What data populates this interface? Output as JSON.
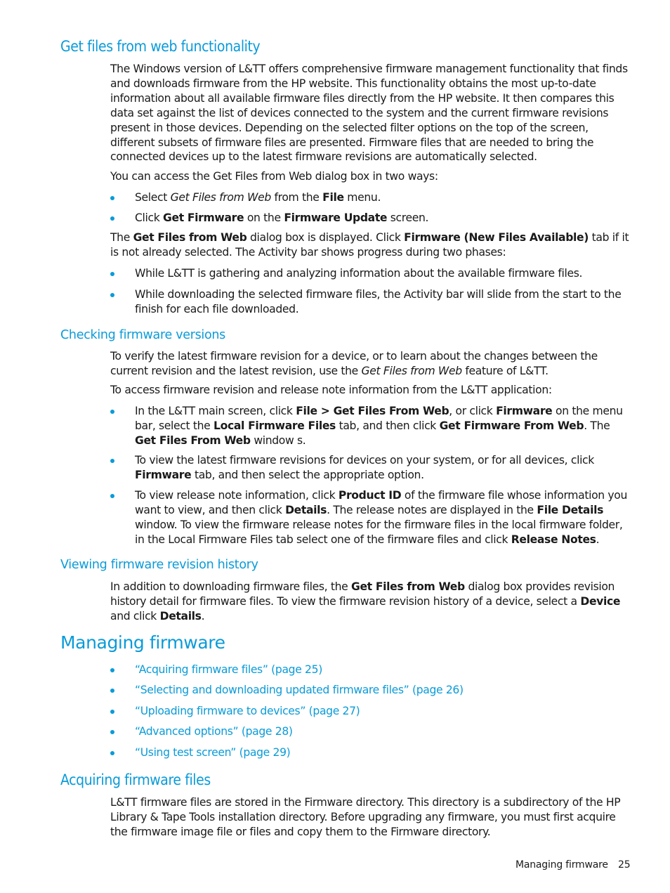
{
  "colors": {
    "accent": "#0a9bd8",
    "text": "#1a1a1a"
  },
  "sections": {
    "get_files": {
      "heading": "Get files from web functionality",
      "p1": "The Windows version of L&TT offers comprehensive firmware management functionality that finds and downloads firmware from the HP website. This functionality obtains the most up-to-date information about all available firmware files directly from the HP website. It then compares this data set against the list of devices connected to the system and the current firmware revisions present in those devices. Depending on the selected filter options on the top of the screen, different subsets of firmware files are presented. Firmware files that are needed to bring the connected devices up to the latest firmware revisions are automatically selected.",
      "p2": "You can access the Get Files from Web dialog box in two ways:",
      "b1": {
        "t1": "Select ",
        "i1": "Get Files from Web",
        "t2": " from the ",
        "b1": "File",
        "t3": " menu."
      },
      "b2": {
        "t1": "Click ",
        "b1": "Get Firmware",
        "t2": " on the ",
        "b2": "Firmware Update",
        "t3": " screen."
      },
      "p3": {
        "t1": "The ",
        "b1": "Get Files from Web",
        "t2": " dialog box is displayed. Click ",
        "b2": "Firmware (New Files Available)",
        "t3": " tab if it is not already selected. The Activity bar shows progress during two phases:"
      },
      "b3": "While L&TT is gathering and analyzing information about the available firmware files.",
      "b4": "While downloading the selected firmware files, the Activity bar will slide from the start to the finish for each file downloaded."
    },
    "checking": {
      "heading": "Checking firmware versions",
      "p1": {
        "t1": "To verify the latest firmware revision for a device, or to learn about the changes between the current revision and the latest revision, use the ",
        "i1": "Get Files from Web",
        "t2": " feature of L&TT."
      },
      "p2": "To access firmware revision and release note information from the L&TT application:",
      "b1": {
        "t1": "In the L&TT main screen, click ",
        "b1": "File > Get Files From Web",
        "t2": ", or click ",
        "b2": "Firmware",
        "t3": " on the menu bar, select the ",
        "b3": "Local Firmware Files",
        "t4": " tab, and then click ",
        "b4": "Get Firmware From Web",
        "t5": ". The ",
        "b5": "Get Files From Web",
        "t6": " window s."
      },
      "b2": {
        "t1": "To view the latest firmware revisions for devices on your system, or for all devices, click ",
        "b1": "Firmware",
        "t2": " tab, and then select the appropriate option."
      },
      "b3": {
        "t1": "To view release note information, click ",
        "b1": "Product ID",
        "t2": " of the firmware file whose information you want to view, and then click ",
        "b2": "Details",
        "t3": ". The release notes are displayed in the ",
        "b3": "File Details",
        "t4": " window. To view the firmware release notes for the firmware files in the local firmware folder, in the Local Firmware Files tab select one of the firmware files and click ",
        "b4": "Release Notes",
        "t5": "."
      }
    },
    "history": {
      "heading": "Viewing firmware revision history",
      "p1": {
        "t1": "In addition to downloading firmware files, the ",
        "b1": "Get Files from Web",
        "t2": " dialog box provides revision history detail for firmware files. To view the firmware revision history of a device, select a ",
        "b2": "Device",
        "t3": " and click ",
        "b3": "Details",
        "t4": "."
      }
    },
    "managing": {
      "heading": "Managing firmware",
      "links": [
        "“Acquiring firmware files” (page 25)",
        "“Selecting and downloading updated firmware files” (page 26)",
        "“Uploading firmware to devices” (page 27)",
        "“Advanced options” (page 28)",
        "“Using test screen” (page 29)"
      ]
    },
    "acquiring": {
      "heading": "Acquiring firmware files",
      "p1": "L&TT firmware files are stored in the Firmware directory. This directory is a subdirectory of the HP Library & Tape Tools installation directory. Before upgrading any firmware, you must first acquire the firmware image file or files and copy them to the Firmware directory."
    }
  },
  "footer": {
    "section": "Managing firmware",
    "page": "25"
  }
}
